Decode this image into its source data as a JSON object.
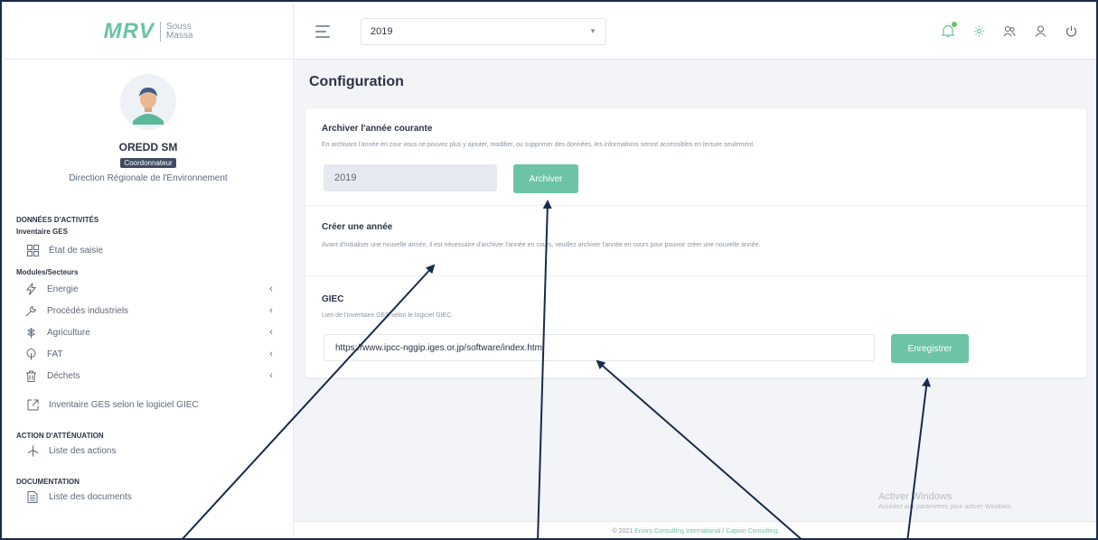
{
  "brand": {
    "logo": "MRV",
    "sub_line1": "Souss",
    "sub_line2": "Massa"
  },
  "profile": {
    "name": "OREDD SM",
    "role": "Coordonnateur",
    "org": "Direction Régionale de l'Environnement"
  },
  "nav": {
    "section_activities": "DONNÉES D'ACTIVITÉS",
    "sub_inventory": "Inventaire GES",
    "item_etat": "État de saisie",
    "sub_modules": "Modules/Secteurs",
    "modules": [
      {
        "label": "Energie",
        "icon": "lightning-icon"
      },
      {
        "label": "Procédés industriels",
        "icon": "wrench-icon"
      },
      {
        "label": "Agriculture",
        "icon": "plant-icon"
      },
      {
        "label": "FAT",
        "icon": "tree-icon"
      },
      {
        "label": "Déchets",
        "icon": "trash-icon"
      }
    ],
    "item_giec": "Inventaire GES selon le logiciel GIEC",
    "section_attenuation": "ACTION D'ATTÉNUATION",
    "item_actions": "Liste des actions",
    "section_documentation": "DOCUMENTATION",
    "item_documents": "Liste des documents"
  },
  "topbar": {
    "year_value": "2019"
  },
  "page": {
    "title": "Configuration"
  },
  "archive": {
    "title": "Archiver l'année courante",
    "description": "En archivant l'année en cour vous ne pouvez plus y ajouter, modifier, ou supprimer des données, les informations seront accessibles en lecture seulement.",
    "year_value": "2019",
    "button": "Archiver"
  },
  "create_year": {
    "title": "Créer une année",
    "description": "Avant d'initialiser une nouvelle année, il est nécessaire d'archiver l'année en cours, veuillez archiver l'année en cours pour pouvoir créer une nouvelle année."
  },
  "giec": {
    "title": "GIEC",
    "description": "Lien de l'inventaire GES selon le logiciel GIEC.",
    "url_value": "https://www.ipcc-nggip.iges.or.jp/software/index.html",
    "button": "Enregistrer"
  },
  "watermark": {
    "title": "Activer Windows",
    "subtitle": "Accédez aux paramètres pour activer Windows."
  },
  "footer": {
    "prefix": "© 2021 ",
    "link1": "Enviro Consulting International",
    "sep": " / ",
    "link2": "Capion Consulting",
    "suffix": "."
  },
  "colors": {
    "accent_green": "#6dc4a4",
    "arrow": "#1a2a4a",
    "sidebar_badge": "#3e4b63"
  }
}
